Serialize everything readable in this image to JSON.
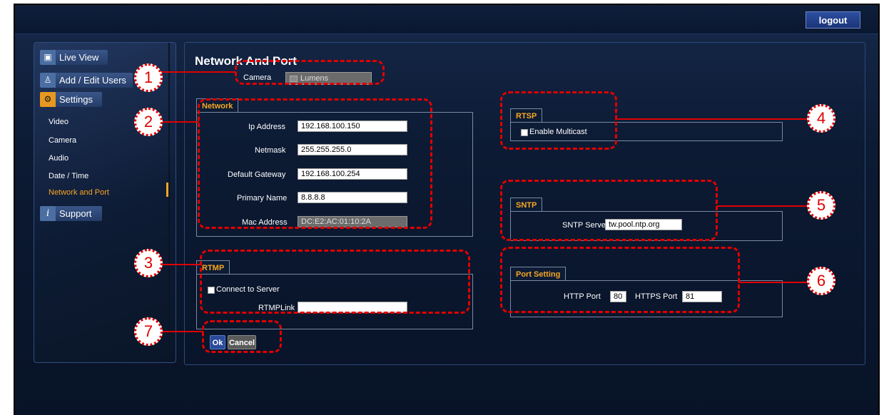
{
  "header": {
    "logout_label": "logout"
  },
  "sidebar": {
    "items": [
      {
        "label": "Live View",
        "icon": "video-icon"
      },
      {
        "label": "Add / Edit Users",
        "icon": "user-icon"
      },
      {
        "label": "Settings",
        "icon": "settings-icon"
      },
      {
        "label": "Support",
        "icon": "info-icon"
      }
    ],
    "subitems": [
      "Video",
      "Camera",
      "Audio",
      "Date / Time",
      "Network and Port"
    ],
    "active_subitem": "Network and Port"
  },
  "page": {
    "title": "Network And Port",
    "camera_label": "Camera",
    "camera_value": "Lumens"
  },
  "network": {
    "tab": "Network",
    "ip_label": "Ip Address",
    "ip_value": "192.168.100.150",
    "netmask_label": "Netmask",
    "netmask_value": "255.255.255.0",
    "gateway_label": "Default Gateway",
    "gateway_value": "192.168.100.254",
    "primary_label": "Primary Name",
    "primary_value": "8.8.8.8",
    "mac_label": "Mac Address",
    "mac_value": "DC:E2:AC:01:10:2A"
  },
  "rtmp": {
    "tab": "RTMP",
    "connect_label": "Connect to Server",
    "connect_checked": false,
    "link_label": "RTMPLink",
    "link_value": ""
  },
  "rtsp": {
    "tab": "RTSP",
    "multicast_label": "Enable Multicast",
    "multicast_checked": false
  },
  "sntp": {
    "tab": "SNTP",
    "server_label": "SNTP Server",
    "server_value": "tw.pool.ntp.org"
  },
  "port_setting": {
    "tab": "Port Setting",
    "http_label": "HTTP Port",
    "http_value": "80",
    "https_label": "HTTPS Port",
    "https_value": "81"
  },
  "actions": {
    "ok_label": "Ok",
    "cancel_label": "Cancel"
  },
  "callouts": [
    "1",
    "2",
    "3",
    "4",
    "5",
    "6",
    "7"
  ],
  "colors": {
    "accent": "#f6a623",
    "callout": "#e10000",
    "ok_button": "#2a4a9a"
  }
}
